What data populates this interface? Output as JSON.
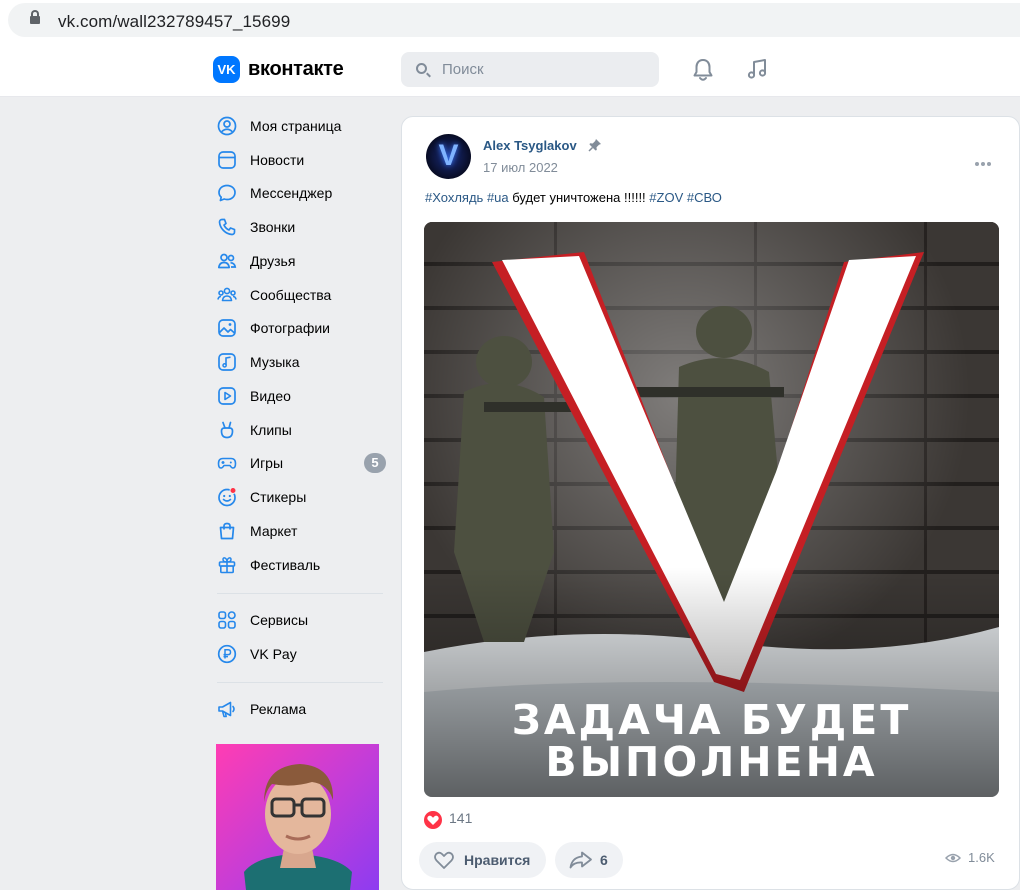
{
  "browser": {
    "url": "vk.com/wall232789457_15699"
  },
  "header": {
    "logo_text": "VK",
    "brand": "вконтакте",
    "search_placeholder": "Поиск",
    "accent": "#0077ff"
  },
  "sidebar": {
    "items": [
      {
        "label": "Моя страница",
        "icon": "user-circle-icon"
      },
      {
        "label": "Новости",
        "icon": "news-icon"
      },
      {
        "label": "Мессенджер",
        "icon": "message-icon"
      },
      {
        "label": "Звонки",
        "icon": "phone-icon"
      },
      {
        "label": "Друзья",
        "icon": "friends-icon"
      },
      {
        "label": "Сообщества",
        "icon": "communities-icon"
      },
      {
        "label": "Фотографии",
        "icon": "photo-icon"
      },
      {
        "label": "Музыка",
        "icon": "music-icon"
      },
      {
        "label": "Видео",
        "icon": "video-icon"
      },
      {
        "label": "Клипы",
        "icon": "clips-icon"
      },
      {
        "label": "Игры",
        "icon": "gamepad-icon",
        "badge": "5"
      },
      {
        "label": "Стикеры",
        "icon": "sticker-icon"
      },
      {
        "label": "Маркет",
        "icon": "market-bag-icon"
      },
      {
        "label": "Фестиваль",
        "icon": "gift-icon"
      }
    ],
    "services": [
      {
        "label": "Сервисы",
        "icon": "services-grid-icon"
      },
      {
        "label": "VK Pay",
        "icon": "vk-pay-icon"
      }
    ],
    "ads": {
      "label": "Реклама",
      "icon": "megaphone-icon"
    }
  },
  "post": {
    "author": "Alex Tsyglakov",
    "avatar_letter": "V",
    "date": "17 июл 2022",
    "text_parts": [
      {
        "text": "#Хохлядь",
        "tag": true
      },
      {
        "text": " ",
        "tag": false
      },
      {
        "text": "#ua",
        "tag": true
      },
      {
        "text": " будет уничтожена !!!!!! ",
        "tag": false
      },
      {
        "text": "#ZOV",
        "tag": true
      },
      {
        "text": " ",
        "tag": false
      },
      {
        "text": "#СВО",
        "tag": true
      }
    ],
    "image_big_letter": "V",
    "image_caption_line1": "ЗАДАЧА БУДЕТ",
    "image_caption_line2": "ВЫПОЛНЕНА",
    "likes_count": "141",
    "like_button": "Нравится",
    "share_count": "6",
    "views": "1.6K"
  }
}
